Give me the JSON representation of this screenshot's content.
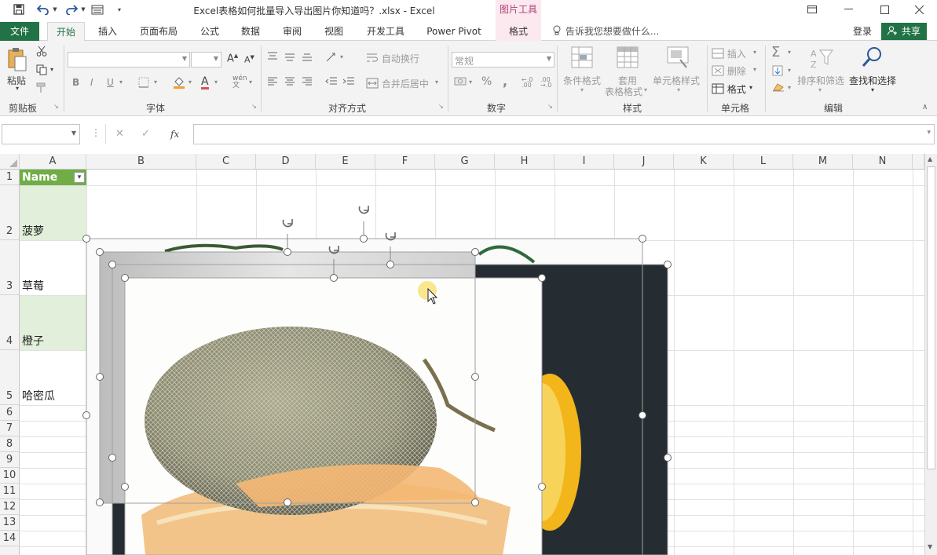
{
  "window": {
    "title": "Excel表格如何批量导入导出图片你知道吗？.xlsx - Excel",
    "context_tab_group": "图片工具",
    "icons": [
      "save-icon",
      "undo-icon",
      "redo-icon",
      "form-icon",
      "customize-qat-icon",
      "ribbon-display-icon",
      "minimize-icon",
      "restore-icon",
      "close-icon"
    ]
  },
  "tabs": {
    "file": "文件",
    "home": "开始",
    "insert": "插入",
    "layout": "页面布局",
    "formulas": "公式",
    "data": "数据",
    "review": "审阅",
    "view": "视图",
    "developer": "开发工具",
    "powerpivot": "Power Pivot",
    "format": "格式"
  },
  "tellme": {
    "text": "告诉我您想要做什么..."
  },
  "account": {
    "login": "登录",
    "share": "共享"
  },
  "ribbon": {
    "clipboard": {
      "label": "剪贴板",
      "paste": "粘贴"
    },
    "font": {
      "label": "字体",
      "bold": "B",
      "italic": "I",
      "underline": "U",
      "grow": "A",
      "shrink": "A",
      "color": "A",
      "phonetic": "wén"
    },
    "alignment": {
      "label": "对齐方式",
      "wrap": "自动换行",
      "merge": "合并后居中"
    },
    "number": {
      "label": "数字",
      "format_value": "常规",
      "percent": "%",
      "comma": ","
    },
    "styles": {
      "label": "样式",
      "conditional": "条件格式",
      "table_l1": "套用",
      "table_l2": "表格格式",
      "cell_styles": "单元格样式"
    },
    "cells": {
      "label": "单元格",
      "insert": "插入",
      "delete": "删除",
      "format": "格式"
    },
    "editing": {
      "label": "编辑",
      "sort": "排序和筛选",
      "find": "查找和选择"
    }
  },
  "formula_bar": {
    "name_box": "",
    "fx": "fx",
    "content": ""
  },
  "columns": [
    "A",
    "B",
    "C",
    "D",
    "E",
    "F",
    "G",
    "H",
    "I",
    "J",
    "K",
    "L",
    "M",
    "N"
  ],
  "rows": [
    "1",
    "2",
    "3",
    "4",
    "5",
    "6",
    "7",
    "8",
    "9",
    "10",
    "11",
    "12",
    "13",
    "14"
  ],
  "cells": {
    "header": "Name",
    "r2": "菠萝",
    "r3": "草莓",
    "r4": "橙子",
    "r5": "哈密瓜"
  },
  "colors": {
    "excel_green": "#217346",
    "context_pink": "#fce9f0",
    "band_green": "#e2efda",
    "header_green": "#70ad47"
  }
}
